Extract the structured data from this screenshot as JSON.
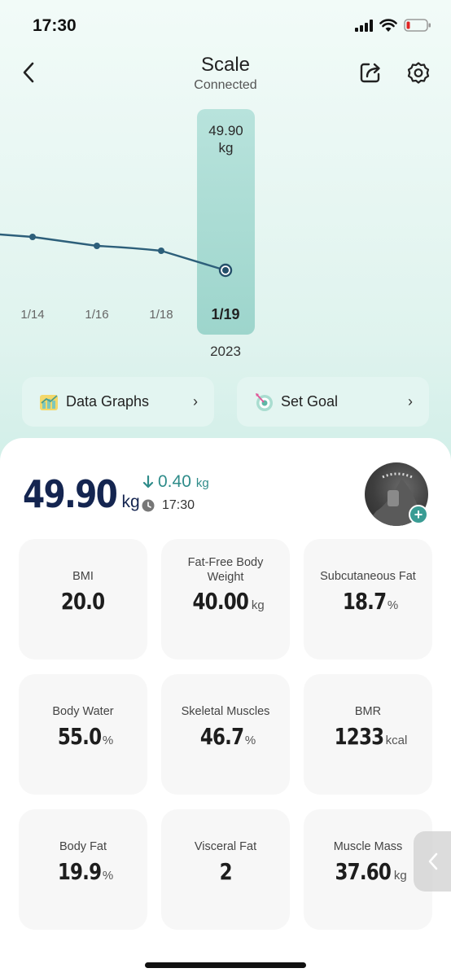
{
  "status": {
    "time": "17:30"
  },
  "header": {
    "title": "Scale",
    "subtitle": "Connected"
  },
  "chart_data": {
    "type": "line",
    "title": "",
    "xlabel": "",
    "ylabel": "",
    "categories": [
      "1/14",
      "1/16",
      "1/18",
      "1/19"
    ],
    "year": "2023",
    "selected": {
      "date": "1/19",
      "value": "49.90",
      "unit": "kg"
    }
  },
  "actions": {
    "data_graphs": "Data Graphs",
    "set_goal": "Set Goal"
  },
  "summary": {
    "weight": "49.90",
    "weight_unit": "kg",
    "change": "0.40",
    "change_unit": "kg",
    "time": "17:30"
  },
  "metrics": [
    {
      "title": "BMI",
      "value": "20.0",
      "unit": ""
    },
    {
      "title": "Fat-Free Body Weight",
      "value": "40.00",
      "unit": "kg"
    },
    {
      "title": "Subcutaneous Fat",
      "value": "18.7",
      "unit": "%"
    },
    {
      "title": "Body Water",
      "value": "55.0",
      "unit": "%"
    },
    {
      "title": "Skeletal Muscles",
      "value": "46.7",
      "unit": "%"
    },
    {
      "title": "BMR",
      "value": "1233",
      "unit": "kcal"
    },
    {
      "title": "Body Fat",
      "value": "19.9",
      "unit": "%"
    },
    {
      "title": "Visceral Fat",
      "value": "2",
      "unit": ""
    },
    {
      "title": "Muscle Mass",
      "value": "37.60",
      "unit": "kg"
    }
  ],
  "colors": {
    "accent": "#2f8c8a",
    "weight": "#142550",
    "line": "#2d5f7a"
  }
}
